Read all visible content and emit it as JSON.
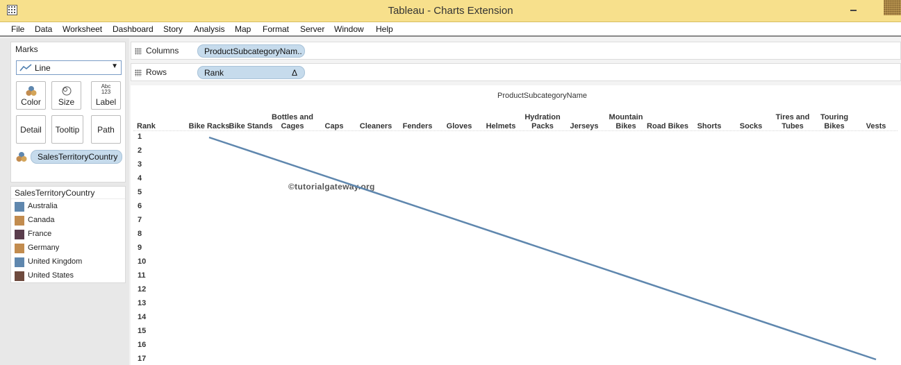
{
  "window": {
    "title": "Tableau - Charts Extension"
  },
  "menu": [
    "File",
    "Data",
    "Worksheet",
    "Dashboard",
    "Story",
    "Analysis",
    "Map",
    "Format",
    "Server",
    "Window",
    "Help"
  ],
  "marks": {
    "title": "Marks",
    "mark_type": "Line",
    "buttons": {
      "color": "Color",
      "size": "Size",
      "label": "Label",
      "detail": "Detail",
      "tooltip": "Tooltip",
      "path": "Path"
    },
    "label_glyph": {
      "abc": "Abc",
      "num": "123"
    },
    "color_field": "SalesTerritoryCountry"
  },
  "legend": {
    "title": "SalesTerritoryCountry",
    "items": [
      {
        "label": "Australia",
        "color": "#5f87ae"
      },
      {
        "label": "Canada",
        "color": "#c28c4f"
      },
      {
        "label": "France",
        "color": "#5a3d4c"
      },
      {
        "label": "Germany",
        "color": "#c28c4f"
      },
      {
        "label": "United Kingdom",
        "color": "#5f87ae"
      },
      {
        "label": "United States",
        "color": "#6e4a3e"
      }
    ]
  },
  "shelves": {
    "columns": {
      "label": "Columns",
      "pill": "ProductSubcategoryNam.."
    },
    "rows": {
      "label": "Rows",
      "pill": "Rank",
      "pill_icon": "Δ"
    }
  },
  "watermark": "©tutorialgateway.org",
  "chart_data": {
    "type": "line",
    "title": "ProductSubcategoryName",
    "ylabel": "Rank",
    "categories": [
      "Bike Racks",
      "Bike Stands",
      "Bottles and Cages",
      "Caps",
      "Cleaners",
      "Fenders",
      "Gloves",
      "Helmets",
      "Hydration Packs",
      "Jerseys",
      "Mountain Bikes",
      "Road Bikes",
      "Shorts",
      "Socks",
      "Tires and Tubes",
      "Touring Bikes",
      "Vests"
    ],
    "y_ticks": [
      "1",
      "2",
      "3",
      "4",
      "5",
      "6",
      "7",
      "8",
      "9",
      "10",
      "11",
      "12",
      "13",
      "14",
      "15",
      "16",
      "17"
    ],
    "ylim": [
      1,
      17
    ],
    "y_reversed": true,
    "series": [
      {
        "color": "#5f87ae",
        "points": [
          {
            "x": "Bike Racks",
            "y": 1
          },
          {
            "x": "Vests",
            "y": 17
          }
        ]
      }
    ]
  }
}
